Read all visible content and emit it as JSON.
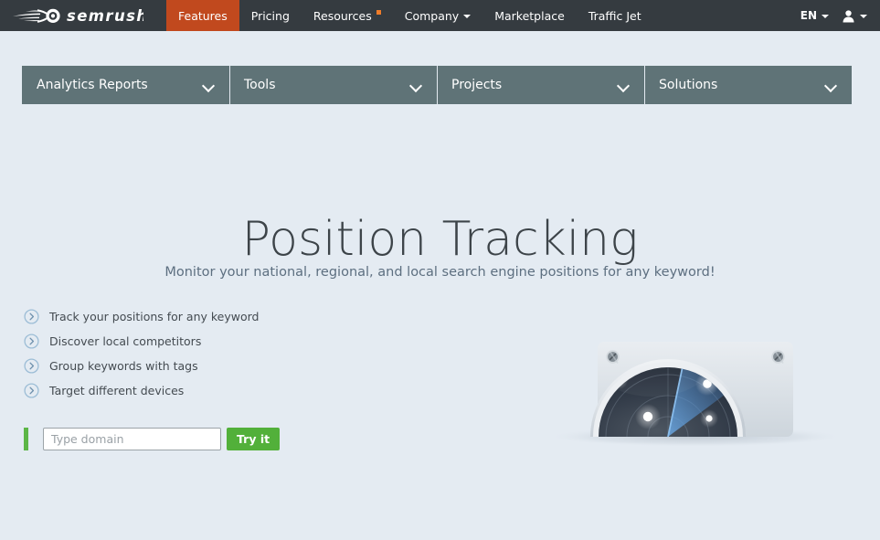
{
  "header": {
    "logo_text": "SEMRUSH",
    "logo_icon": "semrush-comet-logo",
    "nav": [
      {
        "label": "Features",
        "active": true,
        "badge": false,
        "caret": false
      },
      {
        "label": "Pricing",
        "active": false,
        "badge": false,
        "caret": false
      },
      {
        "label": "Resources",
        "active": false,
        "badge": true,
        "caret": false
      },
      {
        "label": "Company",
        "active": false,
        "badge": false,
        "caret": true
      },
      {
        "label": "Marketplace",
        "active": false,
        "badge": false,
        "caret": false
      },
      {
        "label": "Traffic Jet",
        "active": false,
        "badge": false,
        "caret": false
      }
    ],
    "language": "EN",
    "language_icon": "caret-down-icon",
    "account_icon": "user-avatar-icon",
    "account_caret_icon": "caret-down-icon",
    "bar_color": "#353b40",
    "active_color": "#c1491e",
    "badge_color": "#f07c29"
  },
  "subnav": {
    "bar_color": "#5f7377",
    "items": [
      {
        "label": "Analytics Reports",
        "icon": "chevron-down-icon"
      },
      {
        "label": "Tools",
        "icon": "chevron-down-icon"
      },
      {
        "label": "Projects",
        "icon": "chevron-down-icon"
      },
      {
        "label": "Solutions",
        "icon": "chevron-down-icon"
      }
    ]
  },
  "hero": {
    "title": "Position Tracking",
    "subtitle": "Monitor your national, regional, and local search engine positions for any keyword!",
    "title_color": "#3d4449",
    "subtitle_color": "#5d6f80"
  },
  "features": {
    "bullet_icon": "circle-chevron-right-icon",
    "items": [
      {
        "label": "Track your positions for any keyword"
      },
      {
        "label": "Discover local competitors"
      },
      {
        "label": "Group keywords with tags"
      },
      {
        "label": "Target different devices"
      }
    ]
  },
  "search": {
    "accent_bar_color": "#5cb647",
    "placeholder": "Type domain",
    "value": "",
    "button_label": "Try it",
    "button_color": "#52b03a"
  },
  "illustration": {
    "name": "radar-dish-illustration",
    "description": "Half-dome radar screen with concentric range rings, a blue sweep beam and four white blips",
    "blips": 4,
    "sweep_color": "#4f8fd1",
    "screen_color": "#2b3442"
  },
  "page": {
    "background": "#e4ebf2"
  }
}
